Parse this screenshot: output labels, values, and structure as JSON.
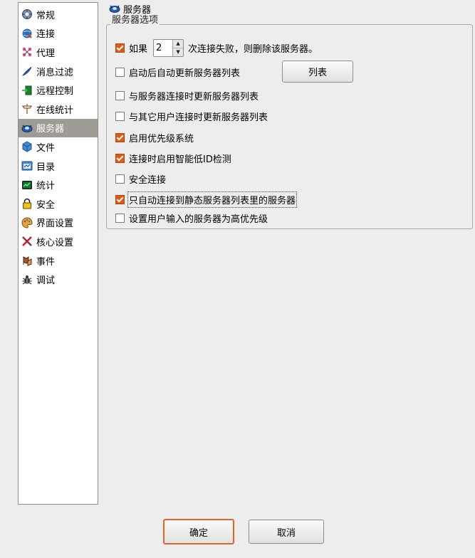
{
  "sidebar": {
    "items": [
      {
        "label": "常规",
        "icon": "general-icon"
      },
      {
        "label": "连接",
        "icon": "connection-icon"
      },
      {
        "label": "代理",
        "icon": "proxy-icon"
      },
      {
        "label": "消息过滤",
        "icon": "message-filter-icon"
      },
      {
        "label": "远程控制",
        "icon": "remote-control-icon"
      },
      {
        "label": "在线统计",
        "icon": "online-stats-icon"
      },
      {
        "label": "服务器",
        "icon": "server-icon",
        "selected": true
      },
      {
        "label": "文件",
        "icon": "file-icon"
      },
      {
        "label": "目录",
        "icon": "directory-icon"
      },
      {
        "label": "统计",
        "icon": "statistics-icon"
      },
      {
        "label": "安全",
        "icon": "security-icon"
      },
      {
        "label": "界面设置",
        "icon": "interface-icon"
      },
      {
        "label": "核心设置",
        "icon": "core-settings-icon"
      },
      {
        "label": "事件",
        "icon": "events-icon"
      },
      {
        "label": "调试",
        "icon": "debug-icon"
      }
    ]
  },
  "panel": {
    "title": "服务器",
    "group_label": "服务器选项",
    "retry": {
      "prefix": "如果",
      "value": "2",
      "suffix": "次连接失败，则删除该服务器。",
      "checked": true
    },
    "options": [
      {
        "label": "启动后自动更新服务器列表",
        "checked": false
      },
      {
        "label": "与服务器连接时更新服务器列表",
        "checked": false
      },
      {
        "label": "与其它用户连接时更新服务器列表",
        "checked": false
      },
      {
        "label": "启用优先级系统",
        "checked": true
      },
      {
        "label": "连接时启用智能低ID检测",
        "checked": true
      },
      {
        "label": "安全连接",
        "checked": false
      },
      {
        "label": "只自动连接到静态服务器列表里的服务器",
        "checked": true
      },
      {
        "label": "设置用户输入的服务器为高优先级",
        "checked": false
      }
    ],
    "list_button": "列表"
  },
  "footer": {
    "ok_label": "确定",
    "cancel_label": "取消"
  },
  "colors": {
    "accent": "#e05a14",
    "selection": "#9e9a95",
    "background": "#ededed"
  }
}
